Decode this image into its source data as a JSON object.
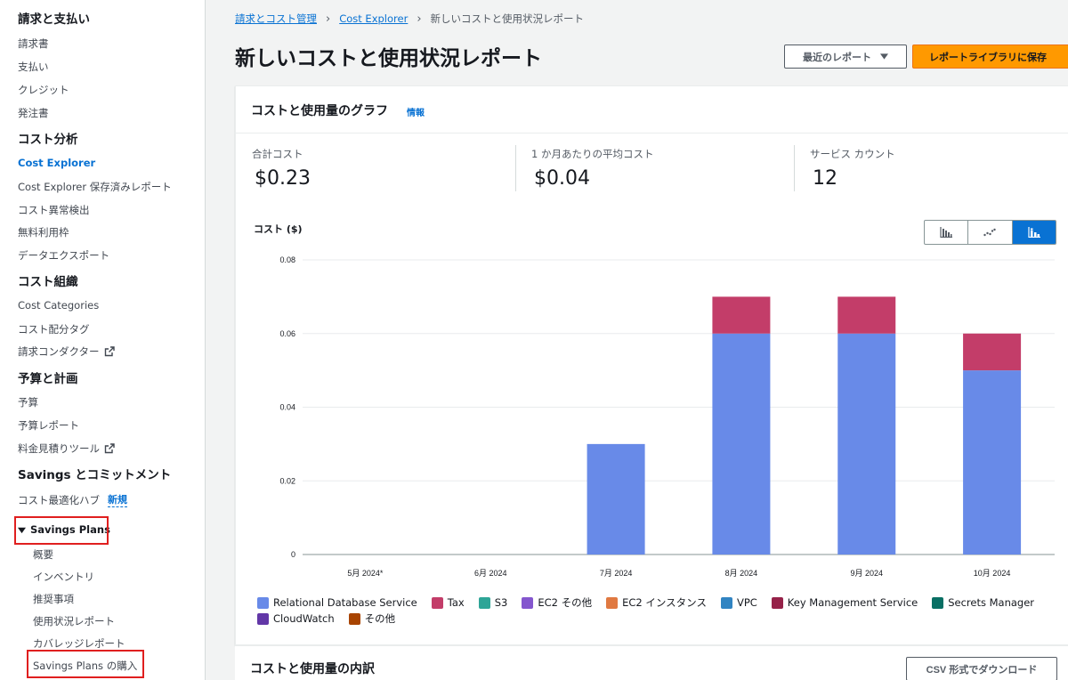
{
  "sidebar": {
    "billing_heading": "請求と支払い",
    "billing_items": [
      "請求書",
      "支払い",
      "クレジット",
      "発注書"
    ],
    "cost_analysis_heading": "コスト分析",
    "cost_analysis_items": [
      "Cost Explorer",
      "Cost Explorer 保存済みレポート",
      "コスト異常検出",
      "無料利用枠",
      "データエクスポート"
    ],
    "cost_org_heading": "コスト組織",
    "cost_org_items": [
      "Cost Categories",
      "コスト配分タグ",
      "請求コンダクター"
    ],
    "budget_heading": "予算と計画",
    "budget_items": [
      "予算",
      "予算レポート",
      "料金見積りツール"
    ],
    "savings_heading": "Savings とコミットメント",
    "savings_hub": "コスト最適化ハブ",
    "new_badge": "新規",
    "savings_plans": "Savings Plans",
    "savings_plans_items": [
      "概要",
      "インベントリ",
      "推奨事項",
      "使用状況レポート",
      "カバレッジレポート",
      "Savings Plans の購入"
    ]
  },
  "breadcrumb": {
    "item1": "請求とコスト管理",
    "item2": "Cost Explorer",
    "current": "新しいコストと使用状況レポート"
  },
  "page": {
    "title": "新しいコストと使用状況レポート",
    "recent_reports": "最近のレポート",
    "save_to_library": "レポートライブラリに保存"
  },
  "graph_panel": {
    "title": "コストと使用量のグラフ",
    "info": "情報",
    "stats": [
      {
        "label": "合計コスト",
        "value": "$0.23"
      },
      {
        "label": "1 か月あたりの平均コスト",
        "value": "$0.04"
      },
      {
        "label": "サービス カウント",
        "value": "12"
      }
    ],
    "chart_type_selected": "stacked-bar"
  },
  "chart_data": {
    "type": "bar",
    "stacked": true,
    "ylabel": "コスト ($)",
    "ylim": [
      0,
      0.08
    ],
    "yticks": [
      "0",
      "0.02",
      "0.04",
      "0.06",
      "0.08"
    ],
    "ytick_values": [
      0,
      0.02,
      0.04,
      0.06,
      0.08
    ],
    "grid": true,
    "categories": [
      "5月 2024*",
      "6月 2024",
      "7月 2024",
      "8月 2024",
      "9月 2024",
      "10月 2024"
    ],
    "series": [
      {
        "name": "Relational Database Service",
        "color": "#688ae8",
        "values": [
          0,
          0,
          0.03,
          0.06,
          0.06,
          0.05
        ]
      },
      {
        "name": "Tax",
        "color": "#c33d69",
        "values": [
          0,
          0,
          0,
          0.01,
          0.01,
          0.01
        ]
      }
    ],
    "legend": [
      {
        "name": "Relational Database Service",
        "color": "#688ae8"
      },
      {
        "name": "Tax",
        "color": "#c33d69"
      },
      {
        "name": "S3",
        "color": "#2ea597"
      },
      {
        "name": "EC2 その他",
        "color": "#8456ce"
      },
      {
        "name": "EC2 インスタンス",
        "color": "#e07941"
      },
      {
        "name": "VPC",
        "color": "#3184c2"
      },
      {
        "name": "Key Management Service",
        "color": "#962249"
      },
      {
        "name": "Secrets Manager",
        "color": "#096f64"
      },
      {
        "name": "CloudWatch",
        "color": "#6237a7"
      },
      {
        "name": "その他",
        "color": "#a84401"
      }
    ],
    "legend_position": "bottom"
  },
  "breakdown_panel": {
    "title": "コストと使用量の内訳",
    "download_csv": "CSV 形式でダウンロード"
  }
}
